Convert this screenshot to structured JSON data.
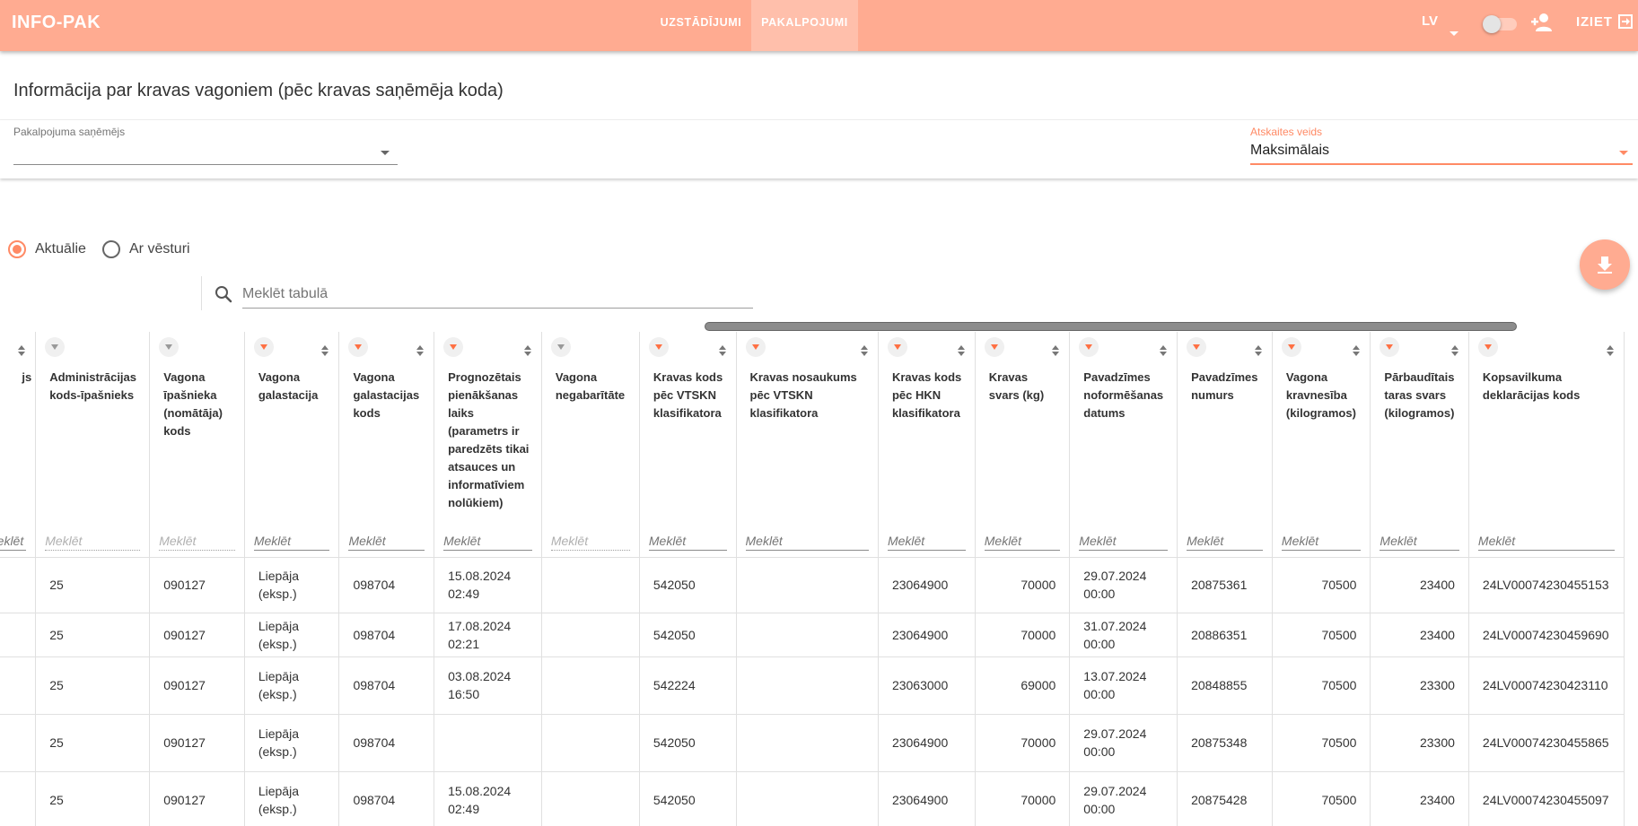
{
  "app": {
    "logo": "INFO-PAK",
    "nav": {
      "settings": "UZSTĀDĪJUMI",
      "services": "PAKALPOJUMI"
    },
    "language": "LV",
    "exit_label": "IZIET",
    "icons": {
      "add_user": "person-add-icon",
      "exit": "exit-icon",
      "download": "download-icon",
      "search": "search-icon"
    },
    "colors": {
      "accent": "#ffab91",
      "accent_dark": "#ff8a65"
    }
  },
  "page": {
    "title": "Informācija par kravas vagoniem (pēc kravas saņēmēja koda)",
    "filters": {
      "recipient_label": "Pakalpojuma saņēmējs",
      "recipient_value": "",
      "report_type_label": "Atskaites veids",
      "report_type_value": "Maksimālais"
    },
    "radios": {
      "current": "Aktuālie",
      "history": "Ar vēsturi",
      "selected": "current"
    },
    "search": {
      "placeholder": "Meklēt tabulā",
      "value": ""
    }
  },
  "table": {
    "filter_placeholder": "Meklēt",
    "columns": [
      {
        "label": "js",
        "align": "left",
        "filter_active": true,
        "filter_enabled": true
      },
      {
        "label": "Administrācijas kods-īpašnieks",
        "align": "left",
        "filter_active": false,
        "filter_enabled": false
      },
      {
        "label": "Vagona īpašnieka (nomātāja) kods",
        "align": "left",
        "filter_active": false,
        "filter_enabled": false
      },
      {
        "label": "Vagona galastacija",
        "align": "left",
        "filter_active": true,
        "filter_enabled": true
      },
      {
        "label": "Vagona galastacijas kods",
        "align": "left",
        "filter_active": true,
        "filter_enabled": true
      },
      {
        "label": "Prognozētais pienākšanas laiks (parametrs ir paredzēts tikai atsauces un informatīviem nolūkiem)",
        "align": "left",
        "filter_active": true,
        "filter_enabled": true
      },
      {
        "label": "Vagona negabarītāte",
        "align": "left",
        "filter_active": false,
        "filter_enabled": false
      },
      {
        "label": "Kravas kods pēc VTSKN klasifikatora",
        "align": "left",
        "filter_active": true,
        "filter_enabled": true
      },
      {
        "label": "Kravas nosaukums pēc VTSKN klasifikatora",
        "align": "left",
        "filter_active": true,
        "filter_enabled": true
      },
      {
        "label": "Kravas kods pēc HKN klasifikatora",
        "align": "left",
        "filter_active": true,
        "filter_enabled": true
      },
      {
        "label": "Kravas svars (kg)",
        "align": "right",
        "filter_active": true,
        "filter_enabled": true
      },
      {
        "label": "Pavadzīmes noformēšanas datums",
        "align": "left",
        "filter_active": true,
        "filter_enabled": true
      },
      {
        "label": "Pavadzīmes numurs",
        "align": "left",
        "filter_active": true,
        "filter_enabled": true
      },
      {
        "label": "Vagona kravnesība (kilogramos)",
        "align": "right",
        "filter_active": true,
        "filter_enabled": true
      },
      {
        "label": "Pārbaudītais taras svars (kilogramos)",
        "align": "right",
        "filter_active": true,
        "filter_enabled": true
      },
      {
        "label": "Kopsavilkuma deklarācijas kods",
        "align": "left",
        "filter_active": true,
        "filter_enabled": true
      }
    ],
    "rows": [
      [
        "",
        "25",
        "090127",
        "Liepāja (eksp.)",
        "098704",
        "15.08.2024 02:49",
        "",
        "542050",
        "",
        "23064900",
        "70000",
        "29.07.2024 00:00",
        "20875361",
        "70500",
        "23400",
        "24LV00074230455153"
      ],
      [
        "",
        "25",
        "090127",
        "Liepāja (eksp.)",
        "098704",
        "17.08.2024 02:21",
        "",
        "542050",
        "",
        "23064900",
        "70000",
        "31.07.2024 00:00",
        "20886351",
        "70500",
        "23400",
        "24LV00074230459690"
      ],
      [
        "",
        "25",
        "090127",
        "Liepāja (eksp.)",
        "098704",
        "03.08.2024 16:50",
        "",
        "542224",
        "",
        "23063000",
        "69000",
        "13.07.2024 00:00",
        "20848855",
        "70500",
        "23300",
        "24LV00074230423110"
      ],
      [
        "",
        "25",
        "090127",
        "Liepāja (eksp.)",
        "098704",
        "",
        "",
        "542050",
        "",
        "23064900",
        "70000",
        "29.07.2024 00:00",
        "20875348",
        "70500",
        "23300",
        "24LV00074230455865"
      ],
      [
        "",
        "25",
        "090127",
        "Liepāja (eksp.)",
        "098704",
        "15.08.2024 02:49",
        "",
        "542050",
        "",
        "23064900",
        "70000",
        "29.07.2024 00:00",
        "20875428",
        "70500",
        "23400",
        "24LV00074230455097"
      ]
    ]
  }
}
